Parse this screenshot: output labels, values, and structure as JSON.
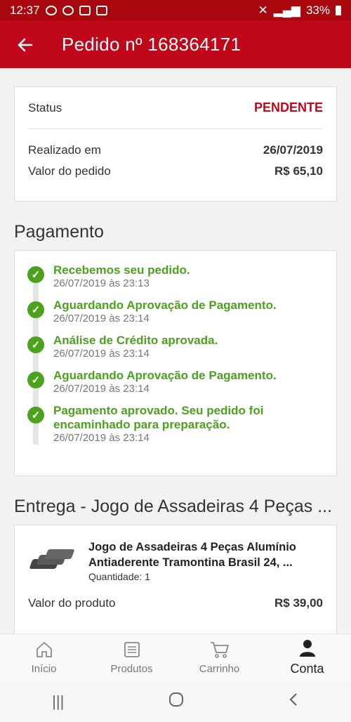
{
  "status_bar": {
    "time": "12:37",
    "battery": "33%"
  },
  "header": {
    "title": "Pedido nº 168364171"
  },
  "summary": {
    "status_label": "Status",
    "status_value": "PENDENTE",
    "date_label": "Realizado em",
    "date_value": "26/07/2019",
    "total_label": "Valor do pedido",
    "total_value": "R$ 65,10"
  },
  "payment": {
    "title": "Pagamento",
    "steps": [
      {
        "label": "Recebemos seu pedido.",
        "date": "26/07/2019 às 23:13"
      },
      {
        "label": "Aguardando Aprovação de Pagamento.",
        "date": "26/07/2019 às 23:14"
      },
      {
        "label": "Análise de Crédito aprovada.",
        "date": "26/07/2019 às 23:14"
      },
      {
        "label": "Aguardando Aprovação de Pagamento.",
        "date": "26/07/2019 às 23:14"
      },
      {
        "label": "Pagamento aprovado. Seu pedido foi encaminhado para preparação.",
        "date": "26/07/2019 às 23:14"
      }
    ]
  },
  "delivery": {
    "title": "Entrega - Jogo de Assadeiras 4 Peças ...",
    "product_name_line1": "Jogo de Assadeiras 4 Peças Alumínio",
    "product_name_line2": "Antiaderente Tramontina Brasil 24, ...",
    "quantity": "Quantidade: 1",
    "value_label": "Valor do produto",
    "value": "R$ 39,00"
  },
  "nav": {
    "items": [
      {
        "label": "Início",
        "icon": "home-icon"
      },
      {
        "label": "Produtos",
        "icon": "list-icon"
      },
      {
        "label": "Carrinho",
        "icon": "cart-icon"
      },
      {
        "label": "Conta",
        "icon": "user-icon"
      }
    ]
  },
  "colors": {
    "brand": "#c0081a",
    "success": "#4aa21d"
  }
}
